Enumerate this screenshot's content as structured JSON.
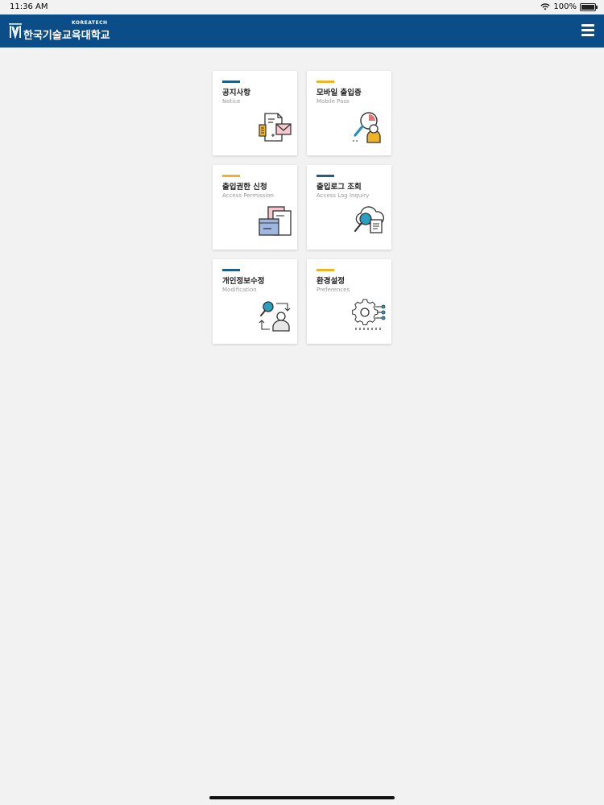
{
  "status": {
    "time": "11:36 AM",
    "battery": "100%"
  },
  "header": {
    "logo_sub": "KOREATECH",
    "logo_title": "한국기술교육대학교"
  },
  "colors": {
    "navy": "#0b4d89",
    "accent_blue": "#1f5d8c",
    "accent_yellow": "#f0b323"
  },
  "menu": [
    {
      "title": "공지사항",
      "subtitle": "Notice",
      "bar": "blue",
      "icon": "notice-document-mail-icon"
    },
    {
      "title": "모바일 출입증",
      "subtitle": "Mobile Pass",
      "bar": "yellow",
      "icon": "mobile-pass-search-user-icon"
    },
    {
      "title": "출입권한 신청",
      "subtitle": "Access Permission",
      "bar": "yellow",
      "icon": "access-permission-folders-icon"
    },
    {
      "title": "출입로그 조회",
      "subtitle": "Access Log Inquiry",
      "bar": "blue",
      "icon": "access-log-cloud-search-icon"
    },
    {
      "title": "개인정보수정",
      "subtitle": "Modification",
      "bar": "blue",
      "icon": "modification-user-search-icon"
    },
    {
      "title": "환경설정",
      "subtitle": "Preferences",
      "bar": "yellow",
      "icon": "preferences-gear-icon"
    }
  ]
}
